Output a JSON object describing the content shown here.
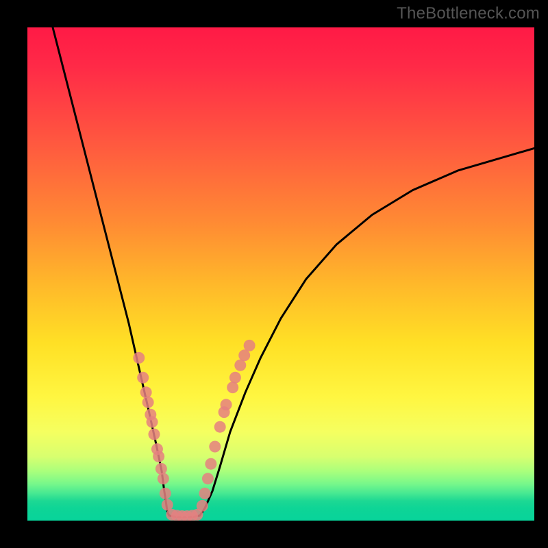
{
  "watermark": "TheBottleneck.com",
  "colors": {
    "frame": "#000000",
    "curve": "#000000",
    "dot": "#e58080"
  },
  "chart_data": {
    "type": "line",
    "title": "",
    "xlabel": "",
    "ylabel": "",
    "xlim": [
      0,
      100
    ],
    "ylim": [
      0,
      100
    ],
    "grid": false,
    "legend": false,
    "series": [
      {
        "name": "left-curve",
        "x": [
          5,
          8,
          11,
          14,
          17,
          20,
          22,
          24,
          25.5,
          26.5,
          27,
          27.3,
          27.5,
          27.7,
          28
        ],
        "y": [
          100,
          88,
          76,
          64,
          52,
          40,
          31,
          22,
          15,
          10,
          6,
          4,
          2.5,
          1.5,
          1
        ]
      },
      {
        "name": "valley-floor",
        "x": [
          28,
          29,
          30,
          31,
          32,
          33,
          34
        ],
        "y": [
          1,
          0.8,
          0.7,
          0.7,
          0.7,
          0.8,
          1
        ]
      },
      {
        "name": "right-curve",
        "x": [
          34,
          35,
          36.5,
          38,
          40,
          43,
          46,
          50,
          55,
          61,
          68,
          76,
          85,
          95,
          100
        ],
        "y": [
          1,
          2.5,
          6,
          11,
          18,
          26,
          33,
          41,
          49,
          56,
          62,
          67,
          71,
          74,
          75.5
        ]
      }
    ],
    "dots_left": [
      {
        "x": 22.0,
        "y": 33.0
      },
      {
        "x": 22.8,
        "y": 29.0
      },
      {
        "x": 23.4,
        "y": 26.0
      },
      {
        "x": 23.8,
        "y": 24.0
      },
      {
        "x": 24.3,
        "y": 21.5
      },
      {
        "x": 24.6,
        "y": 20.0
      },
      {
        "x": 25.0,
        "y": 17.5
      },
      {
        "x": 25.6,
        "y": 14.5
      },
      {
        "x": 25.9,
        "y": 13.0
      },
      {
        "x": 26.4,
        "y": 10.5
      },
      {
        "x": 26.8,
        "y": 8.5
      },
      {
        "x": 27.2,
        "y": 5.5
      },
      {
        "x": 27.6,
        "y": 3.2
      }
    ],
    "dots_right": [
      {
        "x": 34.5,
        "y": 3.0
      },
      {
        "x": 35.0,
        "y": 5.5
      },
      {
        "x": 35.6,
        "y": 8.5
      },
      {
        "x": 36.2,
        "y": 11.5
      },
      {
        "x": 37.0,
        "y": 15.0
      },
      {
        "x": 38.0,
        "y": 19.0
      },
      {
        "x": 38.8,
        "y": 22.0
      },
      {
        "x": 39.2,
        "y": 23.5
      },
      {
        "x": 40.5,
        "y": 27.0
      },
      {
        "x": 41.0,
        "y": 29.0
      },
      {
        "x": 42.0,
        "y": 31.5
      },
      {
        "x": 42.8,
        "y": 33.5
      },
      {
        "x": 43.8,
        "y": 35.5
      }
    ],
    "dots_bottom": [
      {
        "x": 28.5,
        "y": 1.2
      },
      {
        "x": 29.5,
        "y": 1.0
      },
      {
        "x": 30.5,
        "y": 0.9
      },
      {
        "x": 31.5,
        "y": 0.9
      },
      {
        "x": 32.5,
        "y": 1.0
      },
      {
        "x": 33.5,
        "y": 1.2
      }
    ]
  }
}
